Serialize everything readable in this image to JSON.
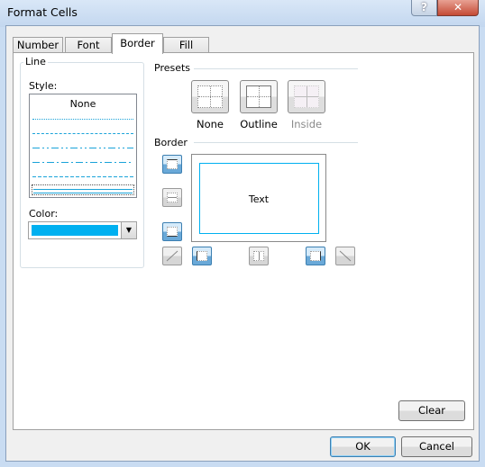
{
  "window": {
    "title": "Format Cells",
    "help_icon": "?",
    "close_icon": "✕"
  },
  "tabs": [
    {
      "label": "Number"
    },
    {
      "label": "Font"
    },
    {
      "label": "Border",
      "selected": true
    },
    {
      "label": "Fill"
    }
  ],
  "line": {
    "group_label": "Line",
    "style_label": "Style:",
    "style_options": [
      "None",
      "dotted",
      "dashed-fine",
      "dash-dot-dot",
      "dash-dot",
      "dashed",
      "double"
    ],
    "style_selected": "double",
    "color_label": "Color:",
    "color_value": "#00b0f0"
  },
  "presets": {
    "label": "Presets",
    "items": [
      {
        "label": "None",
        "enabled": true
      },
      {
        "label": "Outline",
        "enabled": true
      },
      {
        "label": "Inside",
        "enabled": false
      }
    ]
  },
  "border": {
    "label": "Border",
    "preview_text": "Text",
    "border_color": "#00b0f0",
    "buttons": {
      "top": true,
      "inside_horizontal": false,
      "bottom": true,
      "diagonal_up": false,
      "left": true,
      "inside_vertical": false,
      "right": true,
      "diagonal_down": false
    }
  },
  "buttons": {
    "clear": "Clear",
    "ok": "OK",
    "cancel": "Cancel"
  }
}
